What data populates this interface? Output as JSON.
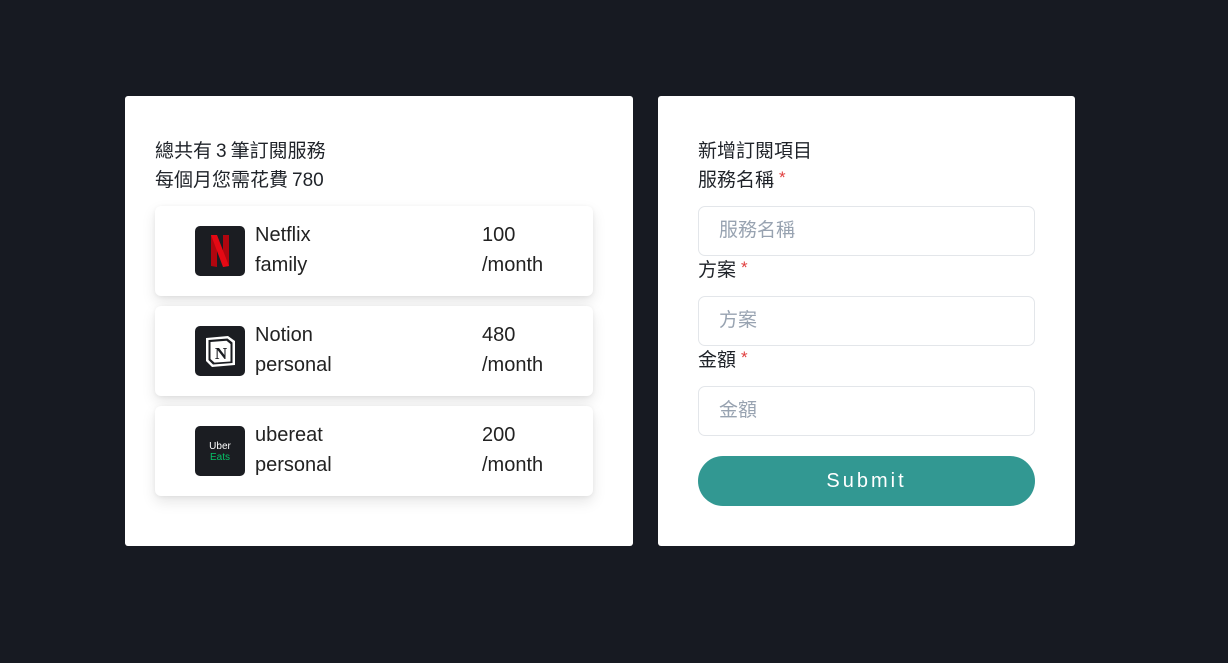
{
  "summary": {
    "count_prefix": "總共有",
    "count": "3",
    "count_suffix": "筆訂閱服務",
    "spend_prefix": "每個月您需花費",
    "spend": "780"
  },
  "subscriptions": [
    {
      "name": "Netflix",
      "plan": "family",
      "amount": "100",
      "unit": "/month",
      "icon": "netflix-logo-icon",
      "logo_text": ""
    },
    {
      "name": "Notion",
      "plan": "personal",
      "amount": "480",
      "unit": "/month",
      "icon": "notion-logo-icon",
      "logo_text": "N"
    },
    {
      "name": "ubereat",
      "plan": "personal",
      "amount": "200",
      "unit": "/month",
      "icon": "ubereats-logo-icon",
      "logo_text": "Uber\nEats"
    }
  ],
  "form": {
    "title": "新增訂閱項目",
    "required_mark": "*",
    "service_label": "服務名稱",
    "service_placeholder": "服務名稱",
    "plan_label": "方案",
    "plan_placeholder": "方案",
    "amount_label": "金額",
    "amount_placeholder": "金額",
    "submit_label": "Submit"
  },
  "colors": {
    "background": "#171a22",
    "accent": "#329892",
    "required": "#e03e3e",
    "netflix_red": "#e50914",
    "ubereats_green": "#06c167"
  }
}
